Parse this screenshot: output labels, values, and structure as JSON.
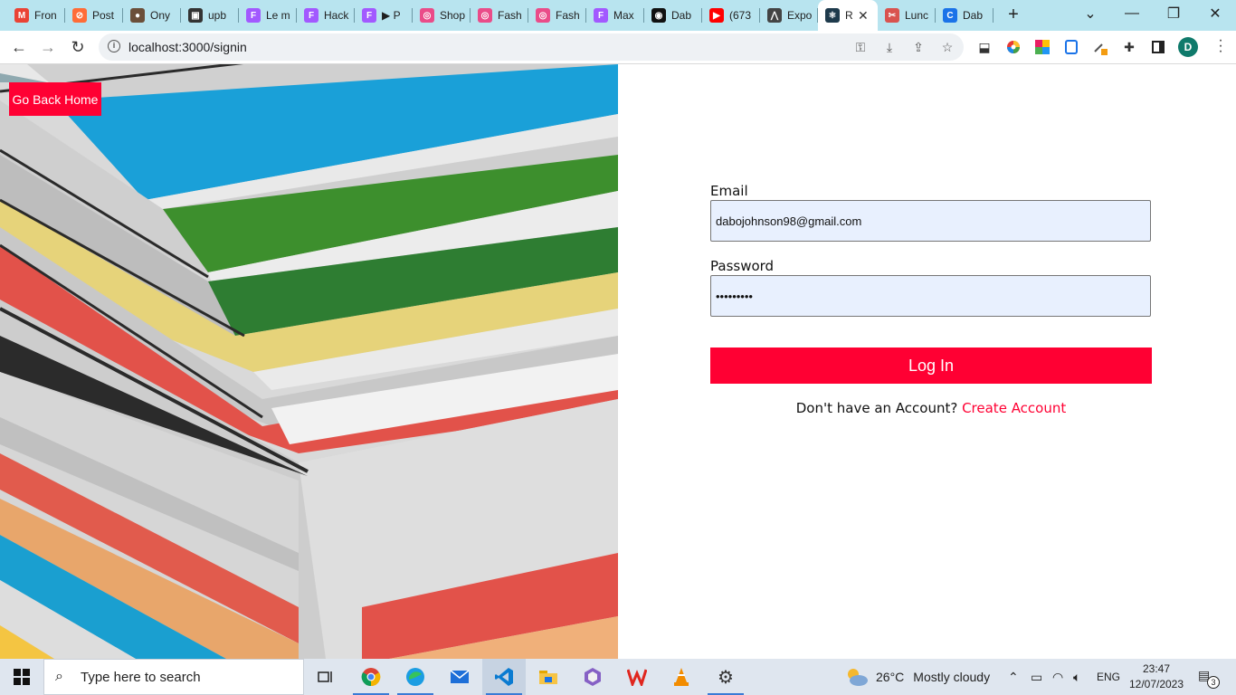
{
  "browser": {
    "tabs": [
      {
        "label": "Fron",
        "icon": "gmail-icon",
        "color": "#ea4335",
        "glyph": "M"
      },
      {
        "label": "Post",
        "icon": "postman-icon",
        "color": "#ff6c37",
        "glyph": "⊘"
      },
      {
        "label": "Ony",
        "icon": "avatar-icon",
        "color": "#6b4f3a",
        "glyph": "●"
      },
      {
        "label": "upb",
        "icon": "cube-icon",
        "color": "#333333",
        "glyph": "▣"
      },
      {
        "label": "Le m",
        "icon": "figma-icon",
        "color": "#a259ff",
        "glyph": "F"
      },
      {
        "label": "Hack",
        "icon": "figma-icon",
        "color": "#a259ff",
        "glyph": "F"
      },
      {
        "label": "▶ P",
        "icon": "figma-icon",
        "color": "#a259ff",
        "glyph": "F"
      },
      {
        "label": "Shop",
        "icon": "dribbble-icon",
        "color": "#ea4c89",
        "glyph": "◎"
      },
      {
        "label": "Fash",
        "icon": "dribbble-icon",
        "color": "#ea4c89",
        "glyph": "◎"
      },
      {
        "label": "Fash",
        "icon": "dribbble-icon",
        "color": "#ea4c89",
        "glyph": "◎"
      },
      {
        "label": "Max",
        "icon": "figma-icon",
        "color": "#a259ff",
        "glyph": "F"
      },
      {
        "label": "Dab",
        "icon": "github-icon",
        "color": "#111111",
        "glyph": "◉"
      },
      {
        "label": "(673",
        "icon": "youtube-icon",
        "color": "#ff0000",
        "glyph": "▶"
      },
      {
        "label": "Expo",
        "icon": "expo-icon",
        "color": "#444444",
        "glyph": "⋀"
      },
      {
        "label": "R",
        "icon": "react-icon",
        "color": "#1e3a4c",
        "glyph": "⚛",
        "active": true
      },
      {
        "label": "Lunc",
        "icon": "scissors-icon",
        "color": "#d9534f",
        "glyph": "✂"
      },
      {
        "label": "Dab",
        "icon": "circle-c-icon",
        "color": "#1a73e8",
        "glyph": "C"
      }
    ],
    "new_tab": "+",
    "window_controls": {
      "dropdown": "⌄",
      "minimize": "—",
      "restore": "❐",
      "close": "✕"
    },
    "nav": {
      "back": "←",
      "forward": "→",
      "reload": "↻"
    },
    "address": "localhost:3000/signin",
    "profile_initial": "D"
  },
  "page": {
    "back_home_label": "Go Back Home",
    "email_label": "Email",
    "email_value": "dabojohnson98@gmail.com",
    "password_label": "Password",
    "password_value": "•••••••••",
    "login_label": "Log In",
    "no_account_text": "Don't have an Account? ",
    "create_account_link": "Create Account",
    "accent_color": "#ff0033"
  },
  "taskbar": {
    "search_placeholder": "Type here to search",
    "weather": {
      "temp": "26°C",
      "condition": "Mostly cloudy"
    },
    "language": "ENG",
    "time": "23:47",
    "date": "12/07/2023",
    "notification_count": "3"
  }
}
